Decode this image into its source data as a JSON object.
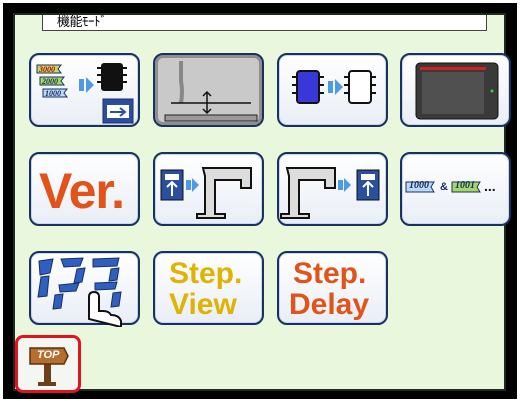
{
  "title": "機能ﾓｰﾄﾞ",
  "buttons": {
    "version": "Ver.",
    "step_view_line1": "Step.",
    "step_view_line2": "View",
    "step_delay_line1": "Step.",
    "step_delay_line2": "Delay",
    "pattern_copy_a": "1000",
    "pattern_copy_b": "1001",
    "pattern_copy_amp": "&",
    "pattern_copy_more": "...",
    "program_numbers": [
      "3000",
      "2000",
      "1000"
    ],
    "top_label": "TOP"
  },
  "colors": {
    "panel_bg": "#e9f7dc",
    "button_border": "#1a2f62",
    "top_border": "#e0141e",
    "version_text": "#e2531a",
    "step_text": "#e0b300"
  }
}
